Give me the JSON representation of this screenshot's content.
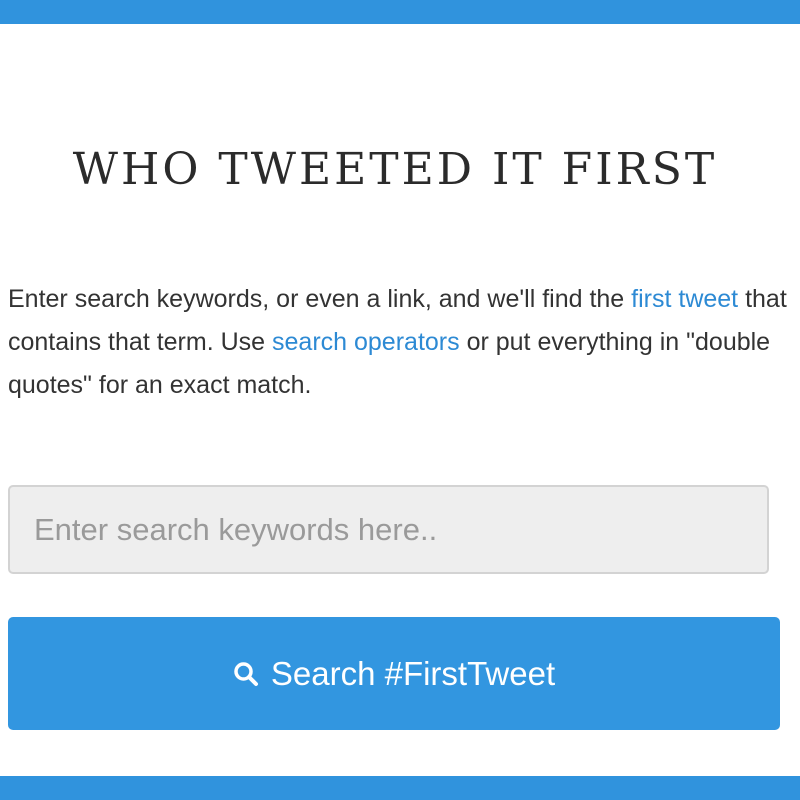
{
  "header": {
    "title": "WHO TWEETED IT FIRST"
  },
  "intro": {
    "text_1": "Enter search keywords, or even a link, and we'll find the ",
    "link_first_tweet": "first tweet",
    "text_2": " that contains that term. Use ",
    "link_search_operators": "search operators",
    "text_3": " or put everything in \"double quotes\" for an exact match."
  },
  "search": {
    "placeholder": "Enter search keywords here..",
    "value": "",
    "button_label": "Search #FirstTweet",
    "icon": "search-icon"
  },
  "colors": {
    "accent": "#3093dd",
    "link": "#2d8ad4",
    "input_background": "#eeeeee"
  }
}
